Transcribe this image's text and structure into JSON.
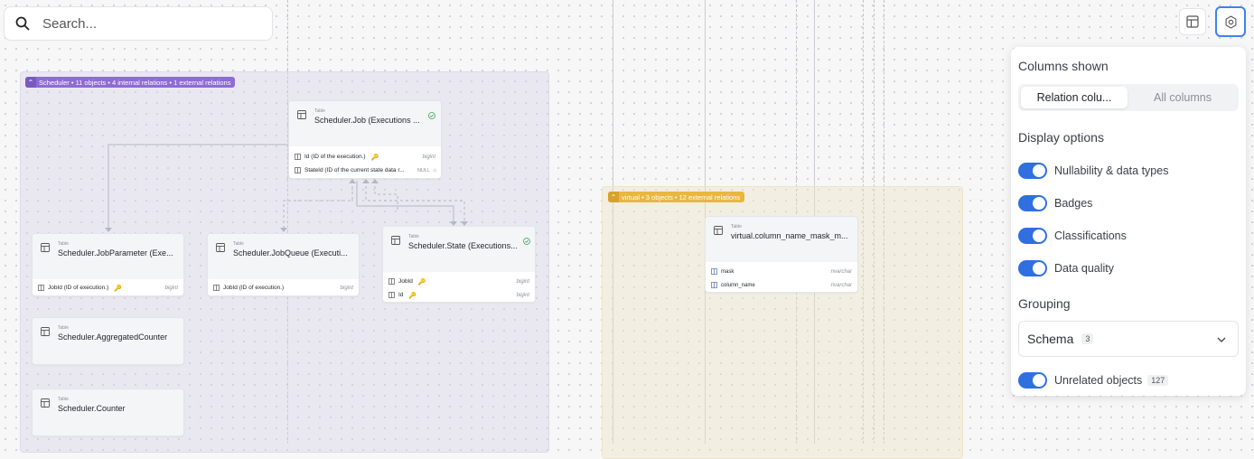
{
  "search": {
    "placeholder": "Search..."
  },
  "groups": {
    "scheduler": {
      "label": "Scheduler • 11 objects • 4 internal relations • 1 external relations",
      "color": "#8e6cd1"
    },
    "virtual": {
      "label": "virtual • 3 objects • 12 external relations",
      "color": "#e9b740"
    }
  },
  "tables": {
    "job": {
      "kind": "Table",
      "title": "Scheduler.Job (Executions ...",
      "rows": [
        {
          "name": "Id (ID of the execution.)",
          "type": "bigint"
        },
        {
          "name": "StateId (ID of the current state data r...",
          "null": "NULL"
        }
      ]
    },
    "jobparameter": {
      "kind": "Table",
      "title": "Scheduler.JobParameter (Exe...",
      "rows": [
        {
          "name": "JobId (ID of execution.)",
          "type": "bigint"
        }
      ]
    },
    "jobqueue": {
      "kind": "Table",
      "title": "Scheduler.JobQueue (Executi...",
      "rows": [
        {
          "name": "JobId (ID of execution.)",
          "type": "bigint"
        }
      ]
    },
    "state": {
      "kind": "Table",
      "title": "Scheduler.State (Executions...",
      "rows": [
        {
          "name": "JobId",
          "type": "bigint"
        },
        {
          "name": "Id",
          "type": "bigint"
        }
      ]
    },
    "aggregated": {
      "kind": "Table",
      "title": "Scheduler.AggregatedCounter"
    },
    "counter": {
      "kind": "Table",
      "title": "Scheduler.Counter"
    },
    "virtual_mask": {
      "kind": "Table",
      "title": "virtual.column_name_mask_m...",
      "rows": [
        {
          "name": "mask",
          "type": "nvarchar"
        },
        {
          "name": "column_name",
          "type": "nvarchar"
        }
      ]
    }
  },
  "panel": {
    "columns_shown_title": "Columns shown",
    "segment": {
      "selected": "Relation colu...",
      "other": "All columns"
    },
    "display_options_title": "Display options",
    "toggles": [
      {
        "label": "Nullability & data types",
        "on": true
      },
      {
        "label": "Badges",
        "on": true
      },
      {
        "label": "Classifications",
        "on": true
      },
      {
        "label": "Data quality",
        "on": true
      }
    ],
    "grouping_title": "Grouping",
    "grouping": {
      "value": "Schema",
      "count": "3"
    },
    "unrelated": {
      "label": "Unrelated objects",
      "count": "127",
      "on": true
    }
  },
  "colors": {
    "accent": "#2f6fe0",
    "focus": "#3b82f6",
    "key": "#d4a017"
  }
}
